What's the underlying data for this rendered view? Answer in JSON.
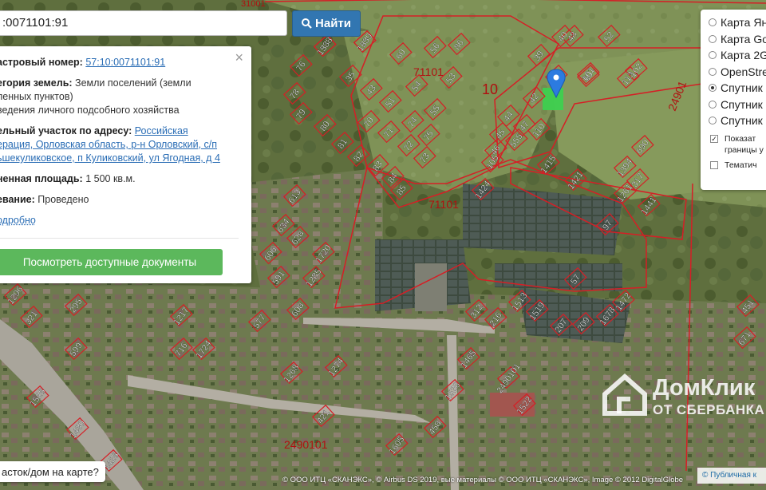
{
  "search": {
    "value": ":0071101:91",
    "button_label": "Найти"
  },
  "info": {
    "cadastral_label": "астровый номер:",
    "cadastral_value": "57:10:0071101:91",
    "category_label": "егория земель:",
    "category_value_1": "Земли поселений (земли",
    "category_value_2": "ленных пунктов)",
    "category_value_3": "ведения личного подсобного хозяйства",
    "address_label": "ельный участок по адресу:",
    "address_1": "Российская",
    "address_2": "ерация, Орловская область, р-н Орловский, с/п",
    "address_3": "ьшекуликовское, п Куликовский, ул Ягодная, д 4",
    "area_label": "ненная площадь:",
    "area_value": "1 500 кв.м.",
    "survey_label": "евание:",
    "survey_value": "Проведено",
    "more_link": "одробно",
    "close": "×",
    "docs_button": "Посмотреть доступные документы"
  },
  "layers": {
    "options": [
      {
        "label": "Карта Ян",
        "selected": false
      },
      {
        "label": "Карта Go",
        "selected": false
      },
      {
        "label": "Карта 2G",
        "selected": false
      },
      {
        "label": "OpenStre",
        "selected": false
      },
      {
        "label": "Спутник",
        "selected": true
      },
      {
        "label": "Спутник",
        "selected": false
      },
      {
        "label": "Спутник",
        "selected": false
      }
    ],
    "check1_line1": "Показат",
    "check1_line2": "границы у",
    "check2": "Тематич"
  },
  "bottom_prompt": "асток/дом на карте?",
  "attribution": "© ООО ИТЦ «СКАНЭКС», © Airbus DS 2019, вые материалы © ООО ИТЦ «СКАНЭКС», Image © 2012 DigitalGlobe",
  "attribution_link": "© Публичная к",
  "watermark": {
    "name": "ДомКлик",
    "sub": "ОТ СБЕРБАНКА"
  },
  "map_labels": {
    "block_a": "71101",
    "block_b": "10",
    "block_c": "71101",
    "block_d": "2490101",
    "block_e": "24901",
    "block_f": "2490101",
    "top_code": "31001",
    "plots": [
      "58",
      "65",
      "60",
      "56",
      "86",
      "53",
      "54",
      "55",
      "76",
      "78",
      "35",
      "43",
      "51",
      "79",
      "80",
      "81",
      "82",
      "83",
      "84",
      "85",
      "70",
      "71",
      "72",
      "73",
      "74",
      "75",
      "39",
      "40",
      "41",
      "42",
      "44",
      "45",
      "46",
      "47",
      "48",
      "50",
      "52",
      "113",
      "105",
      "110",
      "101",
      "102",
      "1424",
      "1415",
      "1421",
      "1261",
      "1441",
      "1394",
      "317",
      "690",
      "97",
      "57",
      "555",
      "613",
      "634",
      "606",
      "628",
      "591",
      "1720",
      "1285",
      "1296",
      "321",
      "295",
      "599",
      "1217",
      "577",
      "608",
      "716",
      "1724",
      "1274",
      "1465",
      "312",
      "216",
      "1513",
      "1519",
      "207",
      "209",
      "421",
      "1268",
      "1526",
      "458",
      "1528",
      "1430",
      "1428",
      "1605",
      "2490101",
      "1522",
      "1678",
      "1472",
      "671",
      "451",
      "1338",
      "1339"
    ]
  }
}
